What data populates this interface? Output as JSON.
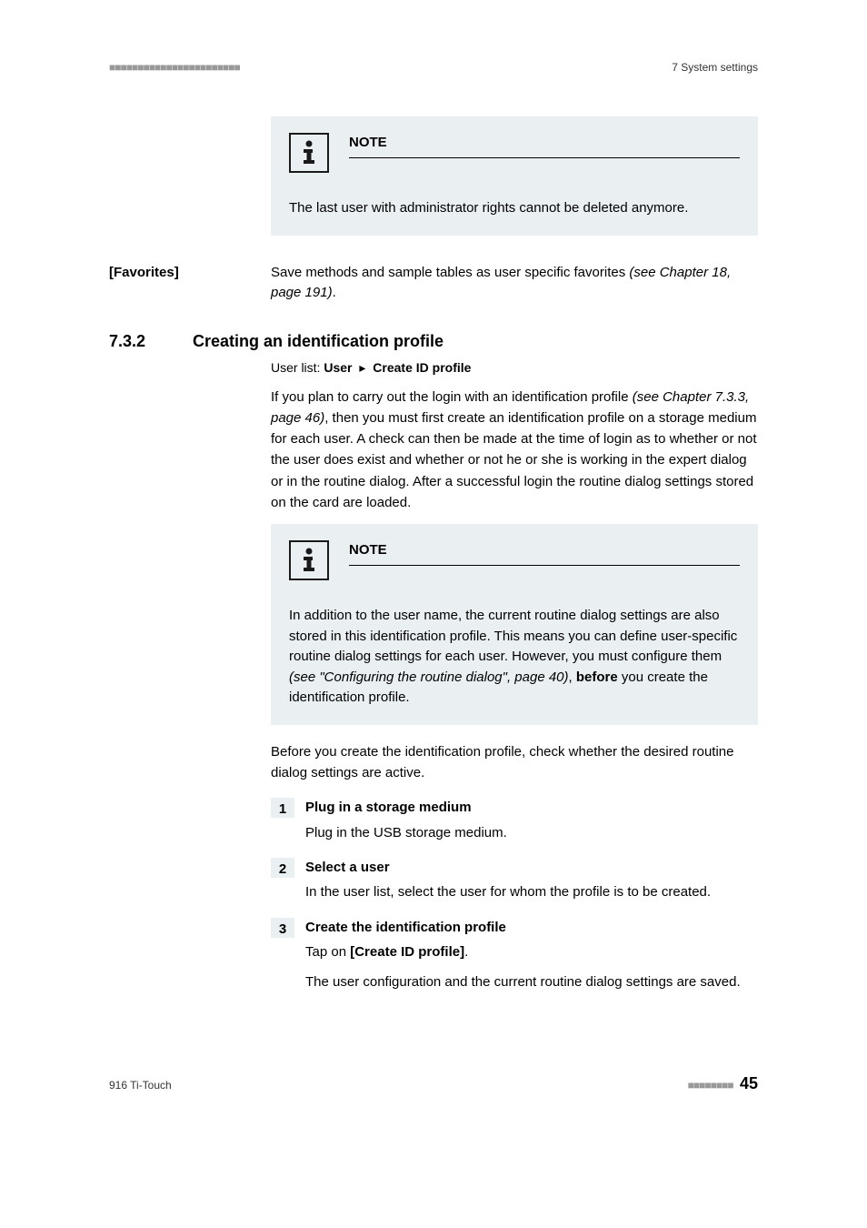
{
  "header": {
    "dashes_left": "■■■■■■■■■■■■■■■■■■■■■■■",
    "right": "7 System settings"
  },
  "note1": {
    "title": "NOTE",
    "body": "The last user with administrator rights cannot be deleted anymore."
  },
  "favorites": {
    "label": "[Favorites]",
    "body_prefix": "Save methods and sample tables as user specific favorites ",
    "body_ref": "(see Chapter 18, page 191)",
    "body_suffix": "."
  },
  "section": {
    "number": "7.3.2",
    "title": "Creating an identification profile"
  },
  "breadcrumb": {
    "prefix": "User list: ",
    "item1": "User",
    "arrow": "▸",
    "item2": "Create ID profile"
  },
  "para1": {
    "p1": "If you plan to carry out the login with an identification profile ",
    "ref": "(see Chapter 7.3.3, page 46)",
    "p2": ", then you must first create an identification profile on a storage medium for each user. A check can then be made at the time of login as to whether or not the user does exist and whether or not he or she is working in the expert dialog or in the routine dialog. After a successful login the routine dialog settings stored on the card are loaded."
  },
  "note2": {
    "title": "NOTE",
    "p1": "In addition to the user name, the current routine dialog settings are also stored in this identification profile. This means you can define user-specific routine dialog settings for each user. However, you must configure them ",
    "ref": "(see \"Configuring the routine dialog\", page 40)",
    "p2": ", ",
    "bold": "before",
    "p3": " you create the identification profile."
  },
  "para2": "Before you create the identification profile, check whether the desired routine dialog settings are active.",
  "steps": [
    {
      "num": "1",
      "title": "Plug in a storage medium",
      "body": "Plug in the USB storage medium."
    },
    {
      "num": "2",
      "title": "Select a user",
      "body": "In the user list, select the user for whom the profile is to be created."
    },
    {
      "num": "3",
      "title": "Create the identification profile",
      "body_prefix": "Tap on ",
      "body_bold": "[Create ID profile]",
      "body_suffix": ".",
      "body2": "The user configuration and the current routine dialog settings are saved."
    }
  ],
  "footer": {
    "left": "916 Ti-Touch",
    "dashes": "■■■■■■■■",
    "page": "45"
  }
}
